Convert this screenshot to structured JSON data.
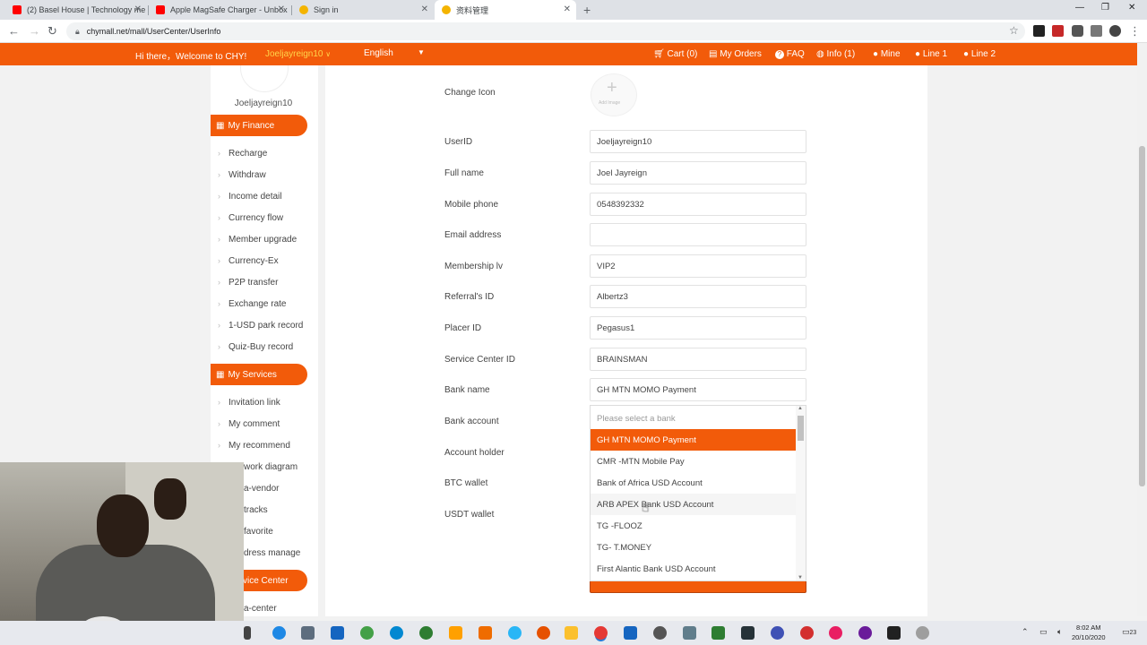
{
  "browser": {
    "tabs": [
      {
        "title": "(2) Basel House | Technology me",
        "icon_color": "#ff0000"
      },
      {
        "title": "Apple MagSafe Charger - Unbox",
        "icon_color": "#ff0000"
      },
      {
        "title": "Sign in",
        "icon_color": "#f4b400"
      },
      {
        "title": "资料管理",
        "icon_color": "#f4b400"
      }
    ],
    "url": "chymall.net/mall/UserCenter/UserInfo"
  },
  "header": {
    "greeting": "Hi there，Welcome to CHY!",
    "username": "Joeljayreign10",
    "language": "English",
    "links": [
      {
        "icon": "cart-icon",
        "glyph": "🛒",
        "label": "Cart (0)"
      },
      {
        "icon": "orders-icon",
        "glyph": "▤",
        "label": "My Orders"
      },
      {
        "icon": "faq-icon",
        "glyph": "?",
        "label": "FAQ"
      },
      {
        "icon": "info-icon",
        "glyph": "◍",
        "label": "Info (1)"
      },
      {
        "icon": "user-icon",
        "glyph": "👤",
        "label": "Mine"
      },
      {
        "icon": "user-icon",
        "glyph": "👤",
        "label": "Line 1"
      },
      {
        "icon": "user-icon",
        "glyph": "👤",
        "label": "Line 2"
      }
    ]
  },
  "sidebar": {
    "username": "Joeljayreign10",
    "finance_title": "My Finance",
    "finance_items": [
      "Recharge",
      "Withdraw",
      "Income detail",
      "Currency flow",
      "Member upgrade",
      "Currency-Ex",
      "P2P transfer",
      "Exchange rate",
      "1-USD park record",
      "Quiz-Buy record"
    ],
    "services_title": "My Services",
    "services_items": [
      "Invitation link",
      "My comment",
      "My recommend",
      "work diagram",
      "a-vendor",
      "tracks",
      "favorite",
      "dress manage"
    ],
    "center_title": "vice Center",
    "center_items": [
      "a-center"
    ]
  },
  "form": {
    "change_icon_label": "Change Icon",
    "add_image_caption": "Add Image",
    "fields": [
      {
        "label": "UserID",
        "value": "Joeljayreign10"
      },
      {
        "label": "Full name",
        "value": "Joel Jayreign"
      },
      {
        "label": "Mobile phone",
        "value": "0548392332"
      },
      {
        "label": "Email address",
        "value": ""
      },
      {
        "label": "Membership lv",
        "value": "VIP2"
      },
      {
        "label": "Referral's ID",
        "value": "Albertz3"
      },
      {
        "label": "Placer ID",
        "value": "Pegasus1"
      },
      {
        "label": "Service Center ID",
        "value": "BRAINSMAN"
      },
      {
        "label": "Bank name",
        "value": "GH MTN MOMO Payment"
      }
    ],
    "labels_below": [
      "Bank account",
      "Account holder",
      "BTC wallet",
      "USDT wallet"
    ],
    "bank_dropdown": {
      "placeholder": "Please select a bank",
      "options": [
        "GH MTN MOMO Payment",
        "CMR -MTN Mobile Pay",
        "Bank of Africa USD Account",
        "ARB APEX Bank USD Account",
        "TG -FLOOZ",
        "TG- T.MONEY",
        "First Alantic Bank USD Account"
      ],
      "selected": "GH MTN MOMO Payment",
      "hovered": "ARB APEX Bank USD Account"
    }
  },
  "taskbar": {
    "time": "8:02 AM",
    "date": "20/10/2020",
    "notification_count": "23"
  },
  "colors": {
    "brand": "#f25b0a",
    "username_highlight": "#ffd54a"
  }
}
